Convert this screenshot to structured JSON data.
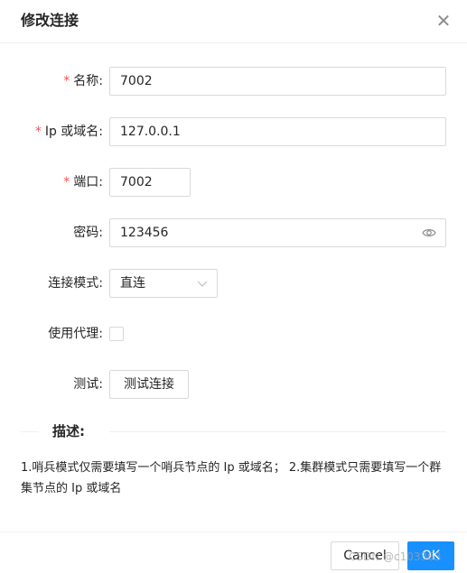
{
  "dialog": {
    "title": "修改连接",
    "close_glyph": "✕"
  },
  "form": {
    "name": {
      "label": "名称:",
      "value": "7002",
      "required": true
    },
    "host": {
      "label": "Ip 或域名:",
      "value": "127.0.0.1",
      "required": true
    },
    "port": {
      "label": "端口:",
      "value": "7002",
      "required": true
    },
    "password": {
      "label": "密码:",
      "value": "123456",
      "icon": "eye-icon"
    },
    "mode": {
      "label": "连接模式:",
      "selected": "直连",
      "icon": "chevron-down-icon"
    },
    "proxy": {
      "label": "使用代理:",
      "checked": false
    },
    "test": {
      "label": "测试:",
      "button": "测试连接"
    }
  },
  "required_mark": "*",
  "description": {
    "heading": "描述:",
    "text": "1.哨兵模式仅需要填写一个哨兵节点的 Ip 或域名； 2.集群模式只需要填写一个群集节点的 Ip 或域名"
  },
  "footer": {
    "cancel_label": "Cancel",
    "ok_label": "OK"
  },
  "watermark": "CSDN @c103363",
  "colors": {
    "primary": "#1890ff",
    "required": "#ff4d4f",
    "border": "#d9d9d9"
  }
}
